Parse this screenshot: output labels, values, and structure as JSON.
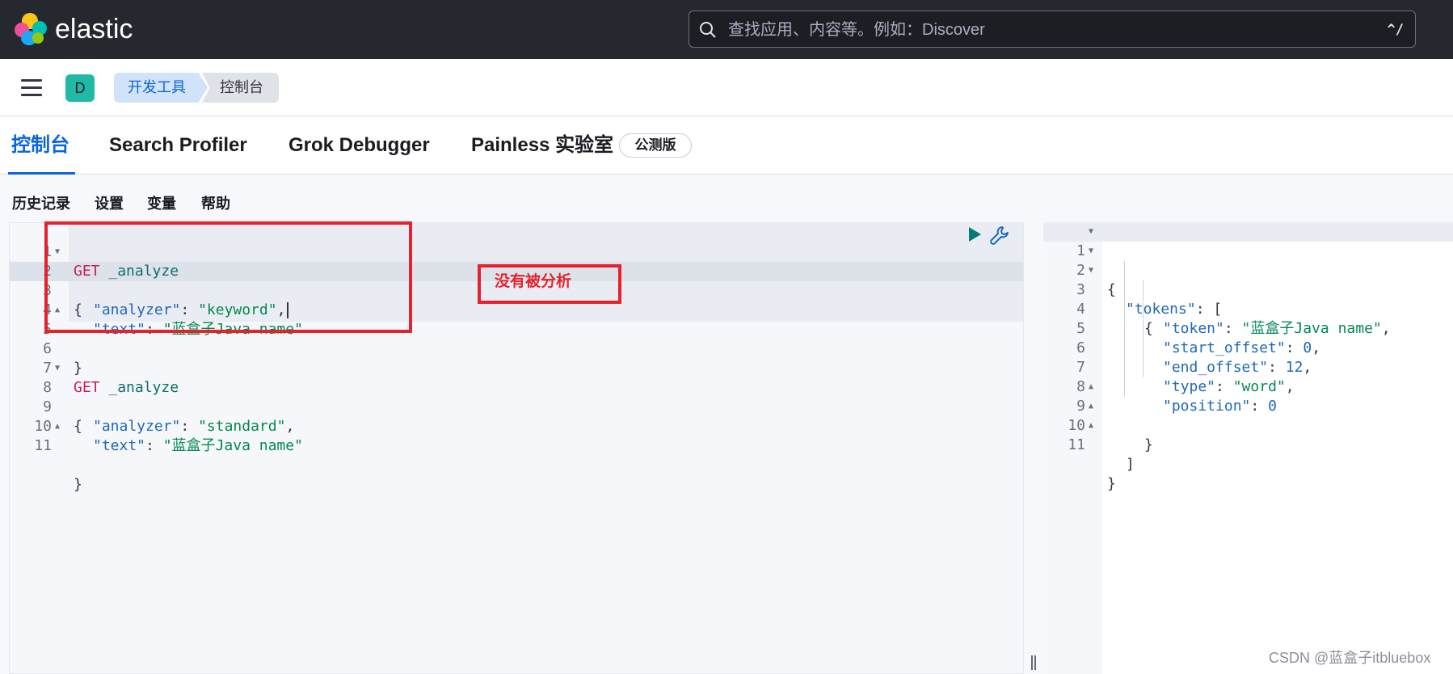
{
  "header": {
    "brand": "elastic",
    "search_placeholder": "查找应用、内容等。例如：Discover",
    "search_shortcut": "^/"
  },
  "subheader": {
    "space_initial": "D",
    "breadcrumbs": [
      "开发工具",
      "控制台"
    ]
  },
  "tabs": [
    {
      "label": "控制台",
      "active": true
    },
    {
      "label": "Search Profiler",
      "active": false
    },
    {
      "label": "Grok Debugger",
      "active": false
    },
    {
      "label": "Painless 实验室",
      "active": false
    }
  ],
  "beta_badge": "公测版",
  "menu": [
    "历史记录",
    "设置",
    "变量",
    "帮助"
  ],
  "editor": {
    "line_numbers": [
      "1",
      "2",
      "3",
      "4",
      "5",
      "6",
      "7",
      "8",
      "9",
      "10",
      "11"
    ],
    "lines": [
      {
        "method": "GET",
        "url": "_analyze"
      },
      {
        "punct": "{"
      },
      {
        "key": "\"analyzer\"",
        "sep": ": ",
        "value": "\"keyword\"",
        "end": ","
      },
      {
        "key": "\"text\"",
        "sep": ": ",
        "value": "\"蓝盒子Java name\"",
        "end": ""
      },
      {
        "punct": "}"
      },
      {},
      {
        "method": "GET",
        "url": "_analyze"
      },
      {
        "punct": "{"
      },
      {
        "key": "\"analyzer\"",
        "sep": ": ",
        "value": "\"standard\"",
        "end": ","
      },
      {
        "key": "\"text\"",
        "sep": ": ",
        "value": "\"蓝盒子Java name\"",
        "end": ""
      },
      {
        "punct": "}"
      }
    ]
  },
  "output": {
    "line_numbers": [
      "1",
      "2",
      "3",
      "4",
      "5",
      "6",
      "7",
      "8",
      "9",
      "10",
      "11"
    ],
    "lines": {
      "l1": "{",
      "l2_key": "\"tokens\"",
      "l2_rest": ": [",
      "l3": "{",
      "l4_key": "\"token\"",
      "l4_val": "\"蓝盒子Java name\"",
      "l5_key": "\"start_offset\"",
      "l5_val": "0",
      "l6_key": "\"end_offset\"",
      "l6_val": "12",
      "l7_key": "\"type\"",
      "l7_val": "\"word\"",
      "l8_key": "\"position\"",
      "l8_val": "0",
      "l9": "}",
      "l10": "]",
      "l11": "}"
    },
    "sep": ": ",
    "comma": ","
  },
  "annotation": {
    "note": "没有被分析",
    "color": "#e5222c"
  },
  "watermark": "CSDN @蓝盒子itbluebox",
  "colors": {
    "header_bg": "#25282f",
    "accent": "#0b64dd",
    "method": "#c61e5f",
    "string": "#028a4f",
    "key": "#1f68b8"
  }
}
